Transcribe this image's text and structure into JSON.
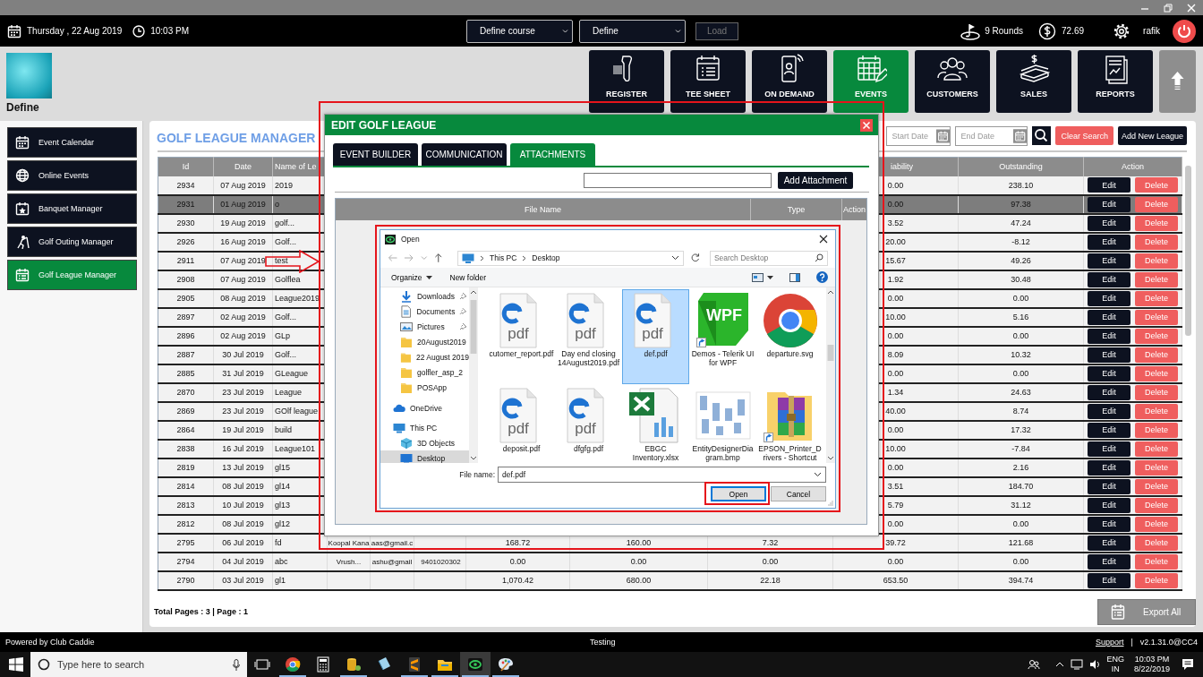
{
  "top_bar": {
    "date": "Thursday ,  22 Aug 2019",
    "time": "10:03 PM",
    "course_select": {
      "value": "Define course"
    },
    "define_select": {
      "value": "Define"
    },
    "load_button": {
      "label": "Load",
      "disabled": true
    },
    "rounds": "9 Rounds",
    "balance": "72.69",
    "user": "rafik"
  },
  "brand": {
    "label": "Define"
  },
  "nav_buttons": [
    {
      "label": "REGISTER",
      "selected": false
    },
    {
      "label": "TEE SHEET",
      "selected": false
    },
    {
      "label": "ON DEMAND",
      "selected": false
    },
    {
      "label": "EVENTS",
      "selected": true
    },
    {
      "label": "CUSTOMERS",
      "selected": false
    },
    {
      "label": "SALES",
      "selected": false
    },
    {
      "label": "REPORTS",
      "selected": false
    }
  ],
  "sidebar": {
    "items": [
      {
        "label": "Event Calendar",
        "selected": false
      },
      {
        "label": "Online Events",
        "selected": false
      },
      {
        "label": "Banquet Manager",
        "selected": false
      },
      {
        "label": "Golf Outing Manager",
        "selected": false
      },
      {
        "label": "Golf League Manager",
        "selected": true
      }
    ]
  },
  "page": {
    "title": "GOLF LEAGUE MANAGER",
    "start_date": {
      "placeholder": "Start Date"
    },
    "end_date": {
      "placeholder": "End Date"
    },
    "clear_button": "Clear Search",
    "add_button": "Add New League",
    "footer": "Total Pages : 3 | Page : 1",
    "export_button": "Export All"
  },
  "table": {
    "columns": {
      "id": "Id",
      "date": "Date",
      "name": "Name of Le",
      "liability": "iability",
      "outstanding": "Outstanding",
      "action": "Action"
    },
    "rows": [
      {
        "id": "2934",
        "date": "07 Aug 2019",
        "name": "2019",
        "liability": "0.00",
        "outstanding": "238.10",
        "edit": "Edit",
        "delete": "Delete",
        "selected": false
      },
      {
        "id": "2931",
        "date": "01 Aug 2019",
        "name": "o",
        "liability": "0.00",
        "outstanding": "97.38",
        "edit": "Edit",
        "delete": "Delete",
        "selected": true
      },
      {
        "id": "2930",
        "date": "19 Aug 2019",
        "name": "golf...",
        "liability": "3.52",
        "outstanding": "47.24",
        "edit": "Edit",
        "delete": "Delete",
        "selected": false
      },
      {
        "id": "2926",
        "date": "16 Aug 2019",
        "name": "Golf...",
        "liability": "20.00",
        "outstanding": "-8.12",
        "edit": "Edit",
        "delete": "Delete",
        "selected": false
      },
      {
        "id": "2911",
        "date": "07 Aug 2019",
        "name": "test",
        "liability": "15.67",
        "outstanding": "49.26",
        "edit": "Edit",
        "delete": "Delete",
        "selected": false
      },
      {
        "id": "2908",
        "date": "07 Aug 2019",
        "name": "Golflea",
        "liability": "1.92",
        "outstanding": "30.48",
        "edit": "Edit",
        "delete": "Delete",
        "selected": false
      },
      {
        "id": "2905",
        "date": "08 Aug 2019",
        "name": "League2019",
        "liability": "0.00",
        "outstanding": "0.00",
        "edit": "Edit",
        "delete": "Delete",
        "selected": false
      },
      {
        "id": "2897",
        "date": "02 Aug 2019",
        "name": "Golf...",
        "liability": "10.00",
        "outstanding": "5.16",
        "edit": "Edit",
        "delete": "Delete",
        "selected": false
      },
      {
        "id": "2896",
        "date": "02 Aug 2019",
        "name": "GLp",
        "liability": "0.00",
        "outstanding": "0.00",
        "edit": "Edit",
        "delete": "Delete",
        "selected": false
      },
      {
        "id": "2887",
        "date": "30 Jul 2019",
        "name": "Golf...",
        "liability": "8.09",
        "outstanding": "10.32",
        "edit": "Edit",
        "delete": "Delete",
        "selected": false
      },
      {
        "id": "2885",
        "date": "31 Jul 2019",
        "name": "GLeague",
        "liability": "0.00",
        "outstanding": "0.00",
        "edit": "Edit",
        "delete": "Delete",
        "selected": false
      },
      {
        "id": "2870",
        "date": "23 Jul 2019",
        "name": "League",
        "liability": "1.34",
        "outstanding": "24.63",
        "edit": "Edit",
        "delete": "Delete",
        "selected": false
      },
      {
        "id": "2869",
        "date": "23 Jul 2019",
        "name": "GOlf league",
        "liability": "40.00",
        "outstanding": "8.74",
        "edit": "Edit",
        "delete": "Delete",
        "selected": false
      },
      {
        "id": "2864",
        "date": "19 Jul 2019",
        "name": "build",
        "liability": "0.00",
        "outstanding": "17.32",
        "edit": "Edit",
        "delete": "Delete",
        "selected": false
      },
      {
        "id": "2838",
        "date": "16 Jul 2019",
        "name": "League101",
        "liability": "10.00",
        "outstanding": "-7.84",
        "edit": "Edit",
        "delete": "Delete",
        "selected": false
      },
      {
        "id": "2819",
        "date": "13 Jul 2019",
        "name": "gl15",
        "liability": "0.00",
        "outstanding": "2.16",
        "edit": "Edit",
        "delete": "Delete",
        "selected": false
      },
      {
        "id": "2814",
        "date": "08 Jul 2019",
        "name": "gl14",
        "liability": "3.51",
        "outstanding": "184.70",
        "edit": "Edit",
        "delete": "Delete",
        "selected": false
      },
      {
        "id": "2813",
        "date": "10 Jul 2019",
        "name": "gl13",
        "liability": "5.79",
        "outstanding": "31.12",
        "edit": "Edit",
        "delete": "Delete",
        "selected": false
      },
      {
        "id": "2812",
        "date": "08 Jul 2019",
        "name": "gl12",
        "liability": "0.00",
        "outstanding": "0.00",
        "edit": "Edit",
        "delete": "Delete",
        "selected": false
      },
      {
        "id": "2795",
        "date": "06 Jul 2019",
        "name": "fd",
        "column_4": "Koopal Kana",
        "column_5": "aas@gmail.c",
        "column_7": "168.72",
        "column_8": "160.00",
        "column_9": "7.32",
        "liability": "39.72",
        "outstanding": "121.68",
        "edit": "Edit",
        "delete": "Delete",
        "selected": false
      },
      {
        "id": "2794",
        "date": "04 Jul 2019",
        "name": "abc",
        "column_4": "Vrush...",
        "column_5": "ashu@gmail",
        "column_6": "9401020302",
        "column_7": "0.00",
        "column_8": "0.00",
        "column_9": "0.00",
        "liability": "0.00",
        "outstanding": "0.00",
        "edit": "Edit",
        "delete": "Delete",
        "selected": false
      },
      {
        "id": "2790",
        "date": "03 Jul 2019",
        "name": "gl1",
        "column_7": "1,070.42",
        "column_8": "680.00",
        "column_9": "22.18",
        "liability": "653.50",
        "outstanding": "394.74",
        "edit": "Edit",
        "delete": "Delete",
        "selected": false
      }
    ]
  },
  "edit_dialog": {
    "title": "EDIT GOLF LEAGUE",
    "tabs": [
      {
        "label": "EVENT BUILDER",
        "selected": false
      },
      {
        "label": "COMMUNICATION",
        "selected": false
      },
      {
        "label": "ATTACHMENTS",
        "selected": true
      }
    ],
    "add_attachment": "Add Attachment",
    "columns": [
      "File Name",
      "Type",
      "Action"
    ]
  },
  "open_dialog": {
    "title": "Open",
    "path": [
      "This PC",
      "Desktop"
    ],
    "search": {
      "placeholder": "Search Desktop"
    },
    "organize": "Organize",
    "new_folder": "New folder",
    "quick_access": [
      {
        "label": "Downloads",
        "pinned": true,
        "selected": false
      },
      {
        "label": "Documents",
        "pinned": true,
        "selected": false
      },
      {
        "label": "Pictures",
        "pinned": true,
        "selected": false
      },
      {
        "label": "20August2019",
        "pinned": false,
        "selected": false
      },
      {
        "label": "22 August 2019",
        "pinned": false,
        "selected": false
      },
      {
        "label": "golfler_asp_2",
        "pinned": false,
        "selected": false
      },
      {
        "label": "POSApp",
        "pinned": false,
        "selected": false
      }
    ],
    "locations": [
      {
        "label": "OneDrive",
        "selected": false
      },
      {
        "label": "This PC",
        "selected": false,
        "children": [
          {
            "label": "3D Objects",
            "selected": false
          },
          {
            "label": "Desktop",
            "selected": true
          }
        ]
      }
    ],
    "files": [
      {
        "name": "cutomer_report.pdf",
        "kind": "pdf",
        "icon_text": "pdf",
        "shortcut": false,
        "selected": false
      },
      {
        "name": "Day end closing 14August2019.pdf",
        "kind": "pdf",
        "icon_text": "pdf",
        "shortcut": false,
        "selected": false
      },
      {
        "name": "def.pdf",
        "kind": "pdf",
        "icon_text": "pdf",
        "shortcut": false,
        "selected": true
      },
      {
        "name": "Demos - Telerik UI for WPF",
        "kind": "wpf",
        "icon_text": "WPF",
        "shortcut": true,
        "selected": false
      },
      {
        "name": "departure.svg",
        "kind": "chrome",
        "shortcut": false,
        "selected": false
      },
      {
        "name": "deposit.pdf",
        "kind": "pdf",
        "icon_text": "pdf",
        "shortcut": false,
        "selected": false
      },
      {
        "name": "dfgfg.pdf",
        "kind": "pdf",
        "icon_text": "pdf",
        "shortcut": false,
        "selected": false
      },
      {
        "name": "EBGC Inventory.xlsx",
        "kind": "excel",
        "shortcut": false,
        "selected": false
      },
      {
        "name": "EntityDesignerDiagram.bmp",
        "kind": "diagram",
        "shortcut": false,
        "selected": false
      },
      {
        "name": "EPSON_Printer_Drivers - Shortcut",
        "kind": "archive",
        "shortcut": true,
        "selected": false
      }
    ],
    "file_name_label": "File name:",
    "file_name": "def.pdf",
    "open_button": "Open",
    "cancel_button": "Cancel"
  },
  "status_bar": {
    "left": "Powered by Club Caddie",
    "center": "Testing",
    "link": "Support",
    "separator": "|",
    "version": "v2.1.31.0@CC4"
  },
  "taskbar": {
    "search": {
      "placeholder": "Type here to search"
    },
    "apps": [
      {
        "kind": "taskview",
        "running": false,
        "selected": false
      },
      {
        "kind": "chrome",
        "running": true,
        "selected": false
      },
      {
        "kind": "calculator",
        "running": false,
        "selected": false
      },
      {
        "kind": "database",
        "running": true,
        "selected": false
      },
      {
        "kind": "notes",
        "running": false,
        "selected": false
      },
      {
        "kind": "sublime",
        "running": true,
        "selected": false
      },
      {
        "kind": "explorer",
        "running": true,
        "selected": false
      },
      {
        "kind": "caddie",
        "running": true,
        "selected": true
      },
      {
        "kind": "paint",
        "running": true,
        "selected": false
      }
    ],
    "language": "ENG",
    "region": "IN",
    "time": "10:03 PM",
    "date": "8/22/2019"
  }
}
